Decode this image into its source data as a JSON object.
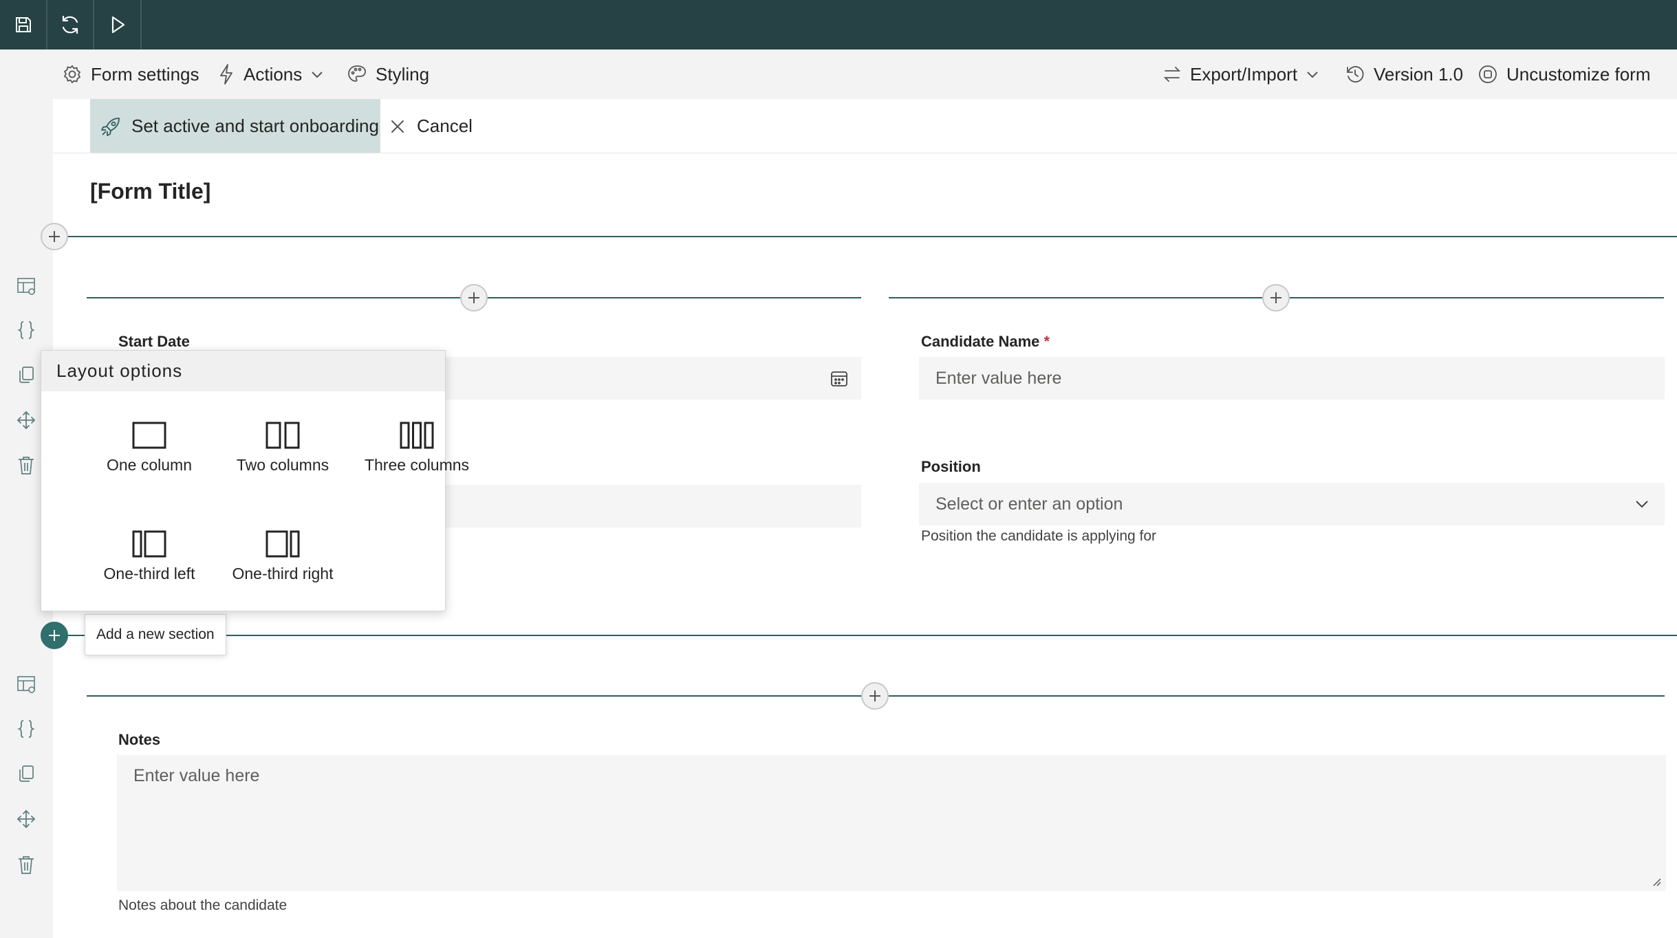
{
  "topbar": {
    "buttons": [
      {
        "icon": "save-icon"
      },
      {
        "icon": "refresh-icon"
      },
      {
        "icon": "play-icon"
      }
    ]
  },
  "commandbar": {
    "form_settings": "Form settings",
    "actions": "Actions",
    "styling": "Styling",
    "export_import": "Export/Import",
    "version": "Version 1.0",
    "uncustomize": "Uncustomize form"
  },
  "actionbar": {
    "primary_label": "Set active and start onboarding",
    "cancel_label": "Cancel"
  },
  "form": {
    "title": "[Form Title]",
    "start_date_label": "Start Date",
    "candidate_name_label": "Candidate Name",
    "required_marker": "*",
    "candidate_name_placeholder": "Enter value here",
    "position_label": "Position",
    "position_placeholder": "Select or enter an option",
    "position_helper": "Position the candidate is applying for",
    "notes_label": "Notes",
    "notes_placeholder": "Enter value here",
    "notes_helper": "Notes about the candidate"
  },
  "layout_popup": {
    "title": "Layout options",
    "options": [
      {
        "label": "One column"
      },
      {
        "label": "Two columns"
      },
      {
        "label": "Three columns"
      },
      {
        "label": "One-third left"
      },
      {
        "label": "One-third right"
      }
    ]
  },
  "tooltip": {
    "text": "Add a new section"
  },
  "colors": {
    "topbar_bg": "#264244",
    "accent": "#2f5d5f",
    "primary_button_bg": "#d0dedd",
    "required": "#c4314b"
  }
}
